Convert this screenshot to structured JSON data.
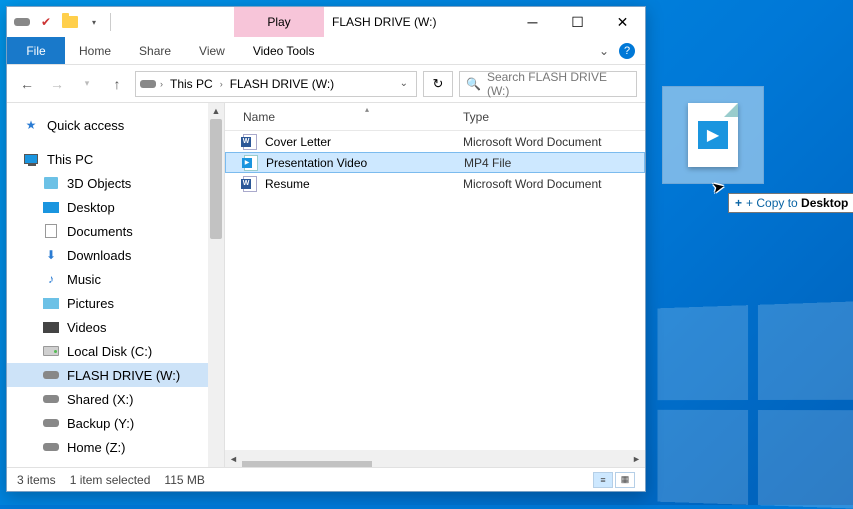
{
  "window": {
    "contextual_tab": "Play",
    "contextual_group": "Video Tools",
    "title": "FLASH DRIVE (W:)"
  },
  "ribbon": {
    "file": "File",
    "tabs": [
      "Home",
      "Share",
      "View"
    ]
  },
  "nav": {
    "crumbs": [
      "This PC",
      "FLASH DRIVE (W:)"
    ],
    "search_placeholder": "Search FLASH DRIVE (W:)"
  },
  "sidebar": {
    "quick_access": "Quick access",
    "this_pc": "This PC",
    "items": [
      "3D Objects",
      "Desktop",
      "Documents",
      "Downloads",
      "Music",
      "Pictures",
      "Videos",
      "Local Disk (C:)",
      "FLASH DRIVE (W:)",
      "Shared (X:)",
      "Backup (Y:)",
      "Home (Z:)"
    ]
  },
  "columns": {
    "name": "Name",
    "type": "Type"
  },
  "files": [
    {
      "name": "Cover Letter",
      "type": "Microsoft Word Document",
      "icon": "word",
      "selected": false
    },
    {
      "name": "Presentation Video",
      "type": "MP4 File",
      "icon": "video",
      "selected": true
    },
    {
      "name": "Resume",
      "type": "Microsoft Word Document",
      "icon": "word",
      "selected": false
    }
  ],
  "status": {
    "count": "3 items",
    "selection": "1 item selected",
    "size": "115 MB"
  },
  "drag": {
    "tooltip_prefix": "+ Copy to ",
    "tooltip_dest": "Desktop"
  }
}
